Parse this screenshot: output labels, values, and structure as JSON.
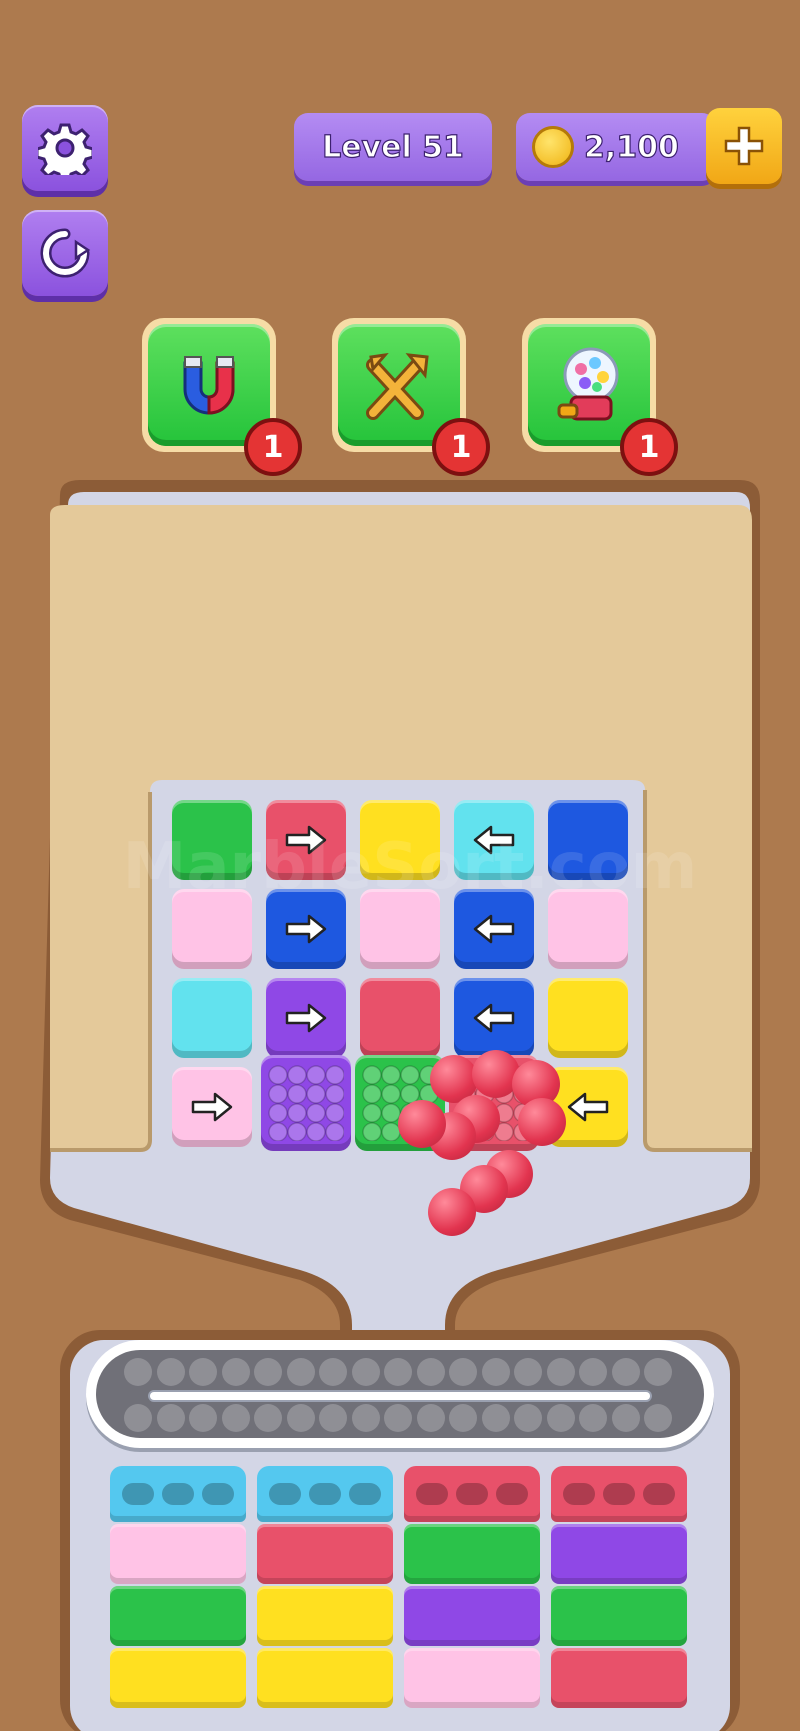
{
  "hud": {
    "level_label": "Level 51",
    "coins": "2,100",
    "settings_icon": "gear-icon",
    "restart_icon": "restart-icon",
    "add_icon": "plus-icon"
  },
  "boosters": [
    {
      "name": "magnet",
      "icon": "magnet-icon",
      "count": "1"
    },
    {
      "name": "shuffle",
      "icon": "shuffle-icon",
      "count": "1"
    },
    {
      "name": "gumball",
      "icon": "gumball-machine-icon",
      "count": "1"
    }
  ],
  "watermark": "MarbleSort.com",
  "board": {
    "rows": [
      [
        {
          "color": "#2bc24a",
          "arrow": ""
        },
        {
          "color": "#e8516a",
          "arrow": "right"
        },
        {
          "color": "#ffe020",
          "arrow": ""
        },
        {
          "color": "#62e2ee",
          "arrow": "left"
        },
        {
          "color": "#1e58e0",
          "arrow": ""
        }
      ],
      [
        {
          "color": "#ffc3e6",
          "arrow": ""
        },
        {
          "color": "#1e58e0",
          "arrow": "right"
        },
        {
          "color": "#ffc3e6",
          "arrow": ""
        },
        {
          "color": "#1e58e0",
          "arrow": "left"
        },
        {
          "color": "#ffc3e6",
          "arrow": ""
        }
      ],
      [
        {
          "color": "#62e2ee",
          "arrow": ""
        },
        {
          "color": "#8f48e6",
          "arrow": "right"
        },
        {
          "color": "#e8516a",
          "arrow": ""
        },
        {
          "color": "#1e58e0",
          "arrow": "left"
        },
        {
          "color": "#ffe020",
          "arrow": ""
        }
      ],
      [
        {
          "color": "#ffc3e6",
          "arrow": "right"
        },
        {
          "color": "#8f48e6",
          "arrow": "bubbles"
        },
        {
          "color": "#2bc24a",
          "arrow": "bubbles"
        },
        {
          "color": "#e8516a",
          "arrow": "bubbles"
        },
        {
          "color": "#ffe020",
          "arrow": "left"
        }
      ]
    ]
  },
  "crates": [
    {
      "lid": "#54c8ef",
      "rows": [
        "#ffc3e6",
        "#2bc24a",
        "#ffe020"
      ]
    },
    {
      "lid": "#54c8ef",
      "rows": [
        "#e8516a",
        "#ffe020",
        "#ffe020"
      ]
    },
    {
      "lid": "#e8516a",
      "rows": [
        "#2bc24a",
        "#8f48e6",
        "#ffc3e6"
      ]
    },
    {
      "lid": "#e8516a",
      "rows": [
        "#8f48e6",
        "#2bc24a",
        "#e8516a"
      ]
    }
  ]
}
